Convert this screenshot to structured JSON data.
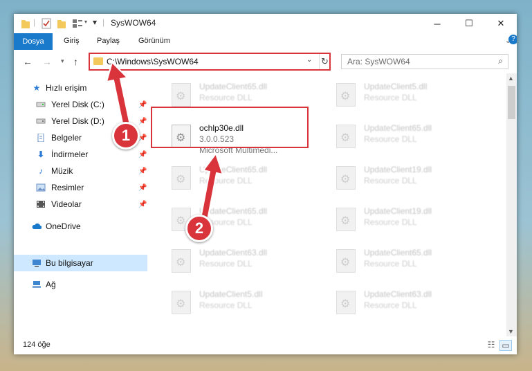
{
  "window": {
    "title": "SysWOW64"
  },
  "ribbon": {
    "tabs": [
      "Dosya",
      "Giriş",
      "Paylaş",
      "Görünüm"
    ]
  },
  "address": {
    "path": "C:\\Windows\\SysWOW64"
  },
  "search": {
    "placeholder": "Ara: SysWOW64"
  },
  "sidebar": {
    "items": [
      {
        "label": "Hızlı erişim",
        "icon": "star-icon"
      },
      {
        "label": "Yerel Disk (C:)",
        "icon": "drive-icon"
      },
      {
        "label": "Yerel Disk (D:)",
        "icon": "drive-icon"
      },
      {
        "label": "Belgeler",
        "icon": "document-icon"
      },
      {
        "label": "İndirmeler",
        "icon": "download-icon"
      },
      {
        "label": "Müzik",
        "icon": "music-icon"
      },
      {
        "label": "Resimler",
        "icon": "picture-icon"
      },
      {
        "label": "Videolar",
        "icon": "video-icon"
      },
      {
        "label": "OneDrive",
        "icon": "cloud-icon"
      },
      {
        "label": "Bu bilgisayar",
        "icon": "computer-icon"
      },
      {
        "label": "Ağ",
        "icon": "network-icon"
      }
    ]
  },
  "files": {
    "left": [
      {
        "name": "UpdateClient65.dll",
        "type": "Resource DLL"
      },
      {
        "name": "ochlp30e.dll",
        "version": "3.0.0.523",
        "type": "Microsoft Multimedi..."
      },
      {
        "name": "UpdateClient65.dll",
        "type": "Resource DLL"
      },
      {
        "name": "UpdateClient65.dll",
        "type": "Resource DLL"
      },
      {
        "name": "UpdateClient63.dll",
        "type": "Resource DLL"
      },
      {
        "name": "UpdateClient5.dll",
        "type": "Resource DLL"
      }
    ],
    "right": [
      {
        "name": "UpdateClient5.dll",
        "type": "Resource DLL"
      },
      {
        "name": "UpdateClient65.dll",
        "type": "Resource DLL"
      },
      {
        "name": "UpdateClient19.dll",
        "type": "Resource DLL"
      },
      {
        "name": "UpdateClient19.dll",
        "type": "Resource DLL"
      },
      {
        "name": "UpdateClient65.dll",
        "type": "Resource DLL"
      },
      {
        "name": "UpdateClient63.dll",
        "type": "Resource DLL"
      }
    ]
  },
  "status": {
    "count": "124 öğe"
  },
  "annotations": {
    "step1": "1",
    "step2": "2",
    "color": "#d9343b"
  }
}
